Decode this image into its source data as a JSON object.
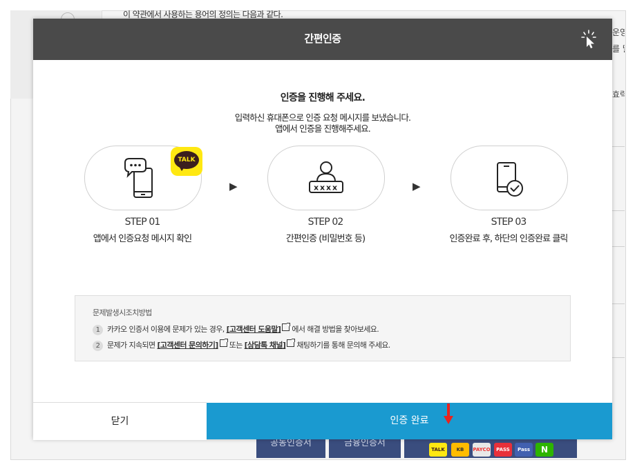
{
  "background": {
    "top_text": "이 약관에서 사용하는 용어의 정의는 다음과 같다.",
    "right_texts": [
      "운영",
      "를 말",
      "효력"
    ],
    "bottom_buttons": [
      "공동인증서",
      "금융인증서"
    ],
    "bottom_logos": [
      "TALK",
      "KB",
      "PAYCO",
      "PASS",
      "Pass",
      "N"
    ]
  },
  "modal": {
    "title": "간편인증",
    "heading": "인증을 진행해 주세요.",
    "description_line1": "입력하신 휴대폰으로 인증 요청 메시지를 보냈습니다.",
    "description_line2": "앱에서 인증을 진행해주세요.",
    "talk_badge": "TALK",
    "arrow_glyph": "▶",
    "steps": [
      {
        "number": "STEP 01",
        "text": "앱에서 인증요청 메시지 확인",
        "icon": "phone-chat-icon"
      },
      {
        "number": "STEP 02",
        "text": "간편인증 (비밀번호 등)",
        "icon": "user-password-icon"
      },
      {
        "number": "STEP 03",
        "text": "인증완료 후, 하단의 인증완료 클릭",
        "icon": "phone-check-icon"
      }
    ],
    "help": {
      "title": "문제발생시조치방법",
      "row1": {
        "num": "1",
        "before": "카카오 인증서 이용에 문제가 있는 경우, ",
        "link": "[고객센터 도움말]",
        "after": "에서 해결 방법을 찾아보세요."
      },
      "row2": {
        "num": "2",
        "before": "문제가 지속되면 ",
        "link1": "[고객센터 문의하기]",
        "middle": "또는 ",
        "link2": "[상담톡 채널]",
        "after": "채팅하기를 통해 문의해 주세요."
      }
    },
    "close_button": "닫기",
    "complete_button": "인증 완료"
  },
  "colors": {
    "header_bg": "#4a4a4a",
    "primary_button": "#1a9ad0",
    "kakao_yellow": "#ffe812",
    "annotation_arrow": "#e8231f"
  }
}
